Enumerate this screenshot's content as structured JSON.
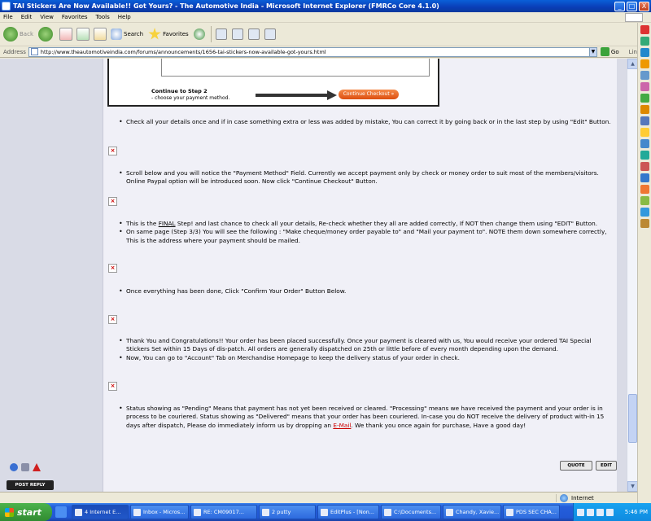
{
  "window": {
    "title": "TAI Stickers Are Now Available!! Got Yours? - The Automotive India - Microsoft Internet Explorer (FMRCo Core 4.1.0)",
    "min": "_",
    "max": "□",
    "close": "X"
  },
  "menu": [
    "File",
    "Edit",
    "View",
    "Favorites",
    "Tools",
    "Help"
  ],
  "toolbar": {
    "back": "Back",
    "search": "Search",
    "favorites": "Favorites"
  },
  "address": {
    "label": "Address",
    "url": "http://www.theautomotiveindia.com/forums/announcements/1656-tai-stickers-now-available-got-yours.html",
    "go": "Go",
    "links": "Links"
  },
  "screenshot": {
    "continue_title": "Continue to Step 2",
    "continue_sub": "- choose your payment method.",
    "checkout_button": "Continue Checkout »"
  },
  "steps": [
    {
      "text": "Check all your details once and if in case something extra or less was added by mistake, You can correct it by going back or in the last step by using \"Edit\" Button."
    },
    {
      "text": "Scroll below and you will notice the \"Payment Method\" Field. Currently we accept payment only by check or money order to suit most of the members/visitors. Online Paypal option will be introduced soon. Now click \"Continue Checkout\" Button."
    },
    {
      "pre": "This is the ",
      "final": "FINAL",
      "post": " Step! and last chance to check all your details, Re-check whether they all are added correctly, If NOT then change them using \"EDIT\" Button."
    },
    {
      "text": "On same page (Step 3/3) You will see the following : \"Make cheque/money order payable to\" and \"Mail your payment to\". NOTE them down somewhere correctly, This is the address where your payment should be mailed."
    },
    {
      "text": "Once everything has been done, Click \"Confirm Your Order\" Button Below."
    },
    {
      "text": "Thank You and Congratulations!! Your order has been placed successfully. Once your payment is cleared with us, You would receive your ordered TAI Special Stickers Set within 15 Days of dis-patch. All orders are generally dispatched on 25th or little before of every month depending upon the demand."
    },
    {
      "text": "Now, You can go to \"Account\" Tab on Merchandise Homepage to keep the delivery status of your order in check."
    },
    {
      "pre": "Status showing as \"Pending\" Means that payment has not yet been received or cleared. \"Processing\" means we have received the payment and your order is in process to be couriered. Status showing as \"Delivered\" means that your order has been couriered. In-case you do NOT receive the delivery of product with-in 15 days after dispatch, Please do immediately inform us by dropping an ",
      "link": "E-Mail",
      "post": ". We thank you once again for purchase, Have a good day!"
    }
  ],
  "broken_image": "×",
  "post_buttons": {
    "quote": "QUOTE",
    "edit": "EDIT",
    "post_reply": "POST REPLY"
  },
  "status": {
    "zone": "Internet"
  },
  "taskbar": {
    "start": "start",
    "tasks": [
      "4 Internet E...",
      "Inbox - Micros...",
      "RE: CM09017...",
      "2 putty",
      "EditPlus - [Non...",
      "C:\\Documents...",
      "Chandy, Xavie...",
      "PDS SEC CHA..."
    ],
    "clock": "5:46 PM"
  }
}
